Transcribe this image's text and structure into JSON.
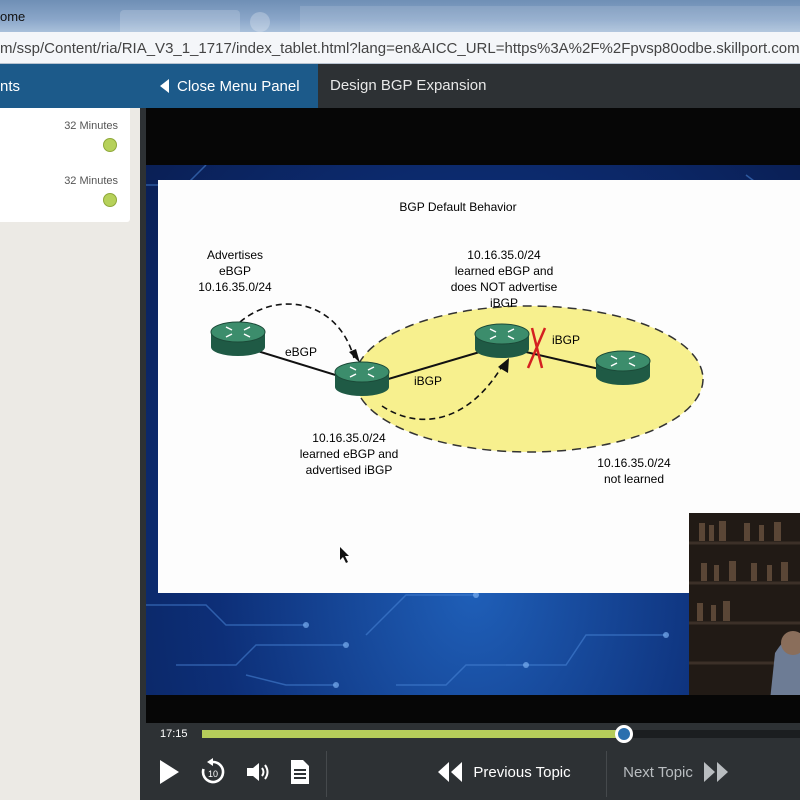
{
  "browser": {
    "title": "ome",
    "url": "m/ssp/Content/ria/RIA_V3_1_1717/index_tablet.html?lang=en&AICC_URL=https%3A%2F%2Fpvsp80odbe.skillport.com"
  },
  "header": {
    "contents_label": "nts",
    "close_menu_label": "Close Menu Panel",
    "course_title": "Design BGP Expansion"
  },
  "sidebar": {
    "items": [
      {
        "duration": "32 Minutes",
        "status_color": "#b6d15a"
      },
      {
        "duration": "32 Minutes",
        "status_color": "#b6d15a"
      }
    ]
  },
  "slide": {
    "title": "BGP Default Behavior",
    "advertises_line1": "Advertises",
    "advertises_line2": "eBGP",
    "advertises_line3": "10.16.35.0/24",
    "top_line1": "10.16.35.0/24",
    "top_line2": "learned eBGP and",
    "top_line3": "does NOT advertise",
    "top_line4": "iBGP",
    "ebgp_label": "eBGP",
    "ibgp_label_mid": "iBGP",
    "ibgp_label_right": "iBGP",
    "mid_line1": "10.16.35.0/24",
    "mid_line2": "learned eBGP and",
    "mid_line3": "advertised iBGP",
    "right_line1": "10.16.35.0/24",
    "right_line2": "not learned"
  },
  "player": {
    "current_time": "17:15",
    "progress_fraction": 0.705,
    "previous_label": "Previous Topic",
    "next_label": "Next Topic",
    "replay_seconds": "10",
    "accent": "#b5cc5a"
  }
}
